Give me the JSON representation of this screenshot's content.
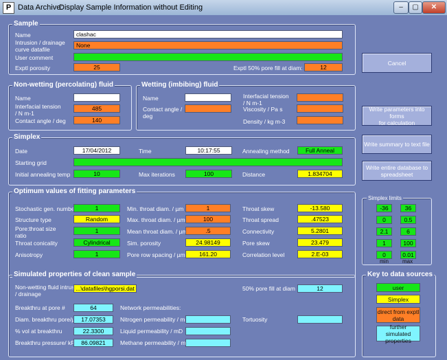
{
  "window": {
    "app": "Data Archive:",
    "title": "Display Sample Information without Editing",
    "icon_letter": "P",
    "min": "–",
    "max": "▢",
    "close": "✕"
  },
  "sample": {
    "heading": "Sample",
    "name_label": "Name",
    "name_value": "clashac",
    "curve_label": "Intrusion / drainage\ncurve datafile",
    "curve_value": "None",
    "comment_label": "User comment",
    "comment_value": "",
    "porosity_label": "Exptl porosity",
    "porosity_value": "25",
    "porefill_label": "Exptl 50% pore fill at diam:",
    "porefill_value": "12"
  },
  "buttons": {
    "cancel": "Cancel",
    "write_params": "Write parameters into forms\nfor calculation",
    "write_summary": "Write summary to text file",
    "write_db": "Write entire database to\nspreadsheet"
  },
  "nonwetting": {
    "heading": "Non-wetting (percolating) fluid",
    "name_label": "Name",
    "name_value": "",
    "tension_label": "Interfacial tension\n/ N m-1",
    "tension_value": "485",
    "angle_label": "Contact angle / deg",
    "angle_value": "140"
  },
  "wetting": {
    "heading": "Wetting (imbibing) fluid",
    "name_label": "Name",
    "name_value": "",
    "angle_label": "Contact angle /\ndeg",
    "angle_value": "",
    "tension_label": "Interfacial tension\n/ N m-1",
    "tension_value": "",
    "viscosity_label": "Viscosity / Pa s",
    "viscosity_value": "",
    "density_label": "Density / kg m-3",
    "density_value": ""
  },
  "simplex": {
    "heading": "Simplex",
    "date_label": "Date",
    "date_value": "17/04/2012",
    "time_label": "Time",
    "time_value": "10:17:55",
    "anneal_label": "Annealing method",
    "anneal_value": "Full Anneal",
    "grid_label": "Starting grid",
    "grid_value": "",
    "temp_label": "Initial annealing temp",
    "temp_value": "10",
    "iter_label": "Max iterations",
    "iter_value": "100",
    "dist_label": "Distance",
    "dist_value": "1.834704"
  },
  "optimum": {
    "heading": "Optimum values of fitting parameters",
    "stoch_label": "Stochastic gen. number",
    "stoch_value": "1",
    "struct_label": "Structure type",
    "struct_value": "Random",
    "ratio_label": "Pore:throat size\nratio",
    "ratio_value": "1",
    "conic_label": "Throat conicality",
    "conic_value": "Cylindrical",
    "aniso_label": "Anisotropy",
    "aniso_value": "1",
    "minthroat_label": "Min. throat diam. /   µm",
    "minthroat_value": "1",
    "maxthroat_label": "Max. throat diam. /   µm",
    "maxthroat_value": "100",
    "meanthroat_label": "Mean throat diam. /   µm",
    "meanthroat_value": ".5",
    "simpor_label": "Sim. porosity",
    "simpor_value": "24.98149",
    "spacing_label": "Pore row spacing /  µm",
    "spacing_value": "161.20",
    "skew_label": "Throat skew",
    "skew_value": "-13.580",
    "spread_label": "Throat spread",
    "spread_value": ".47523",
    "conn_label": "Connectivity",
    "conn_value": "5.2801",
    "poreskew_label": "Pore skew",
    "poreskew_value": "23.479",
    "corr_label": "Correlation level",
    "corr_value": "2.E-03"
  },
  "limits": {
    "heading": "Simplex limits",
    "min_label": "min",
    "max_label": "max",
    "rows": [
      [
        "-36",
        "36"
      ],
      [
        "0",
        "0.5"
      ],
      [
        "2.1",
        "6"
      ],
      [
        "1",
        "100"
      ],
      [
        "0",
        "0.01"
      ]
    ]
  },
  "simulated": {
    "heading": "Simulated properties of clean sample",
    "nw_label": "Non-wetting fluid intrusn\n/ drainage",
    "nw_value": "...\\datafiles\\hgporsi.dat",
    "fill_label": "50% pore fill at diam",
    "fill_value": "12",
    "breakpore_label": "Breakthru at pore #",
    "breakpore_value": "64",
    "breakdiam_label": "Diam. breakthru pore/µm",
    "breakdiam_value": "17.07353",
    "vol_label": "% vol at breakthru",
    "vol_value": "22.3300",
    "press_label": "Breakthru pressure/ kPa",
    "press_value": "86.09821",
    "perm_label": "Network permeabilities:",
    "n2_label": "Nitrogen permeability / mD",
    "n2_value": "",
    "liq_label": "Liquid permeability / mD",
    "liq_value": "",
    "meth_label": "Methane permeability / mD",
    "meth_value": "",
    "tort_label": "Tortuosity",
    "tort_value": ""
  },
  "key": {
    "heading": "Key to data sources",
    "user": "user",
    "simplex": "Simplex",
    "exptl": "direct from exptl\ndata",
    "further": "further simulated\nproperties"
  },
  "colors": {
    "green": "#17e617",
    "yellow": "#ffff00",
    "orange": "#ff7f26",
    "cyan": "#7ff4ff",
    "background": "#6f7fb6"
  }
}
